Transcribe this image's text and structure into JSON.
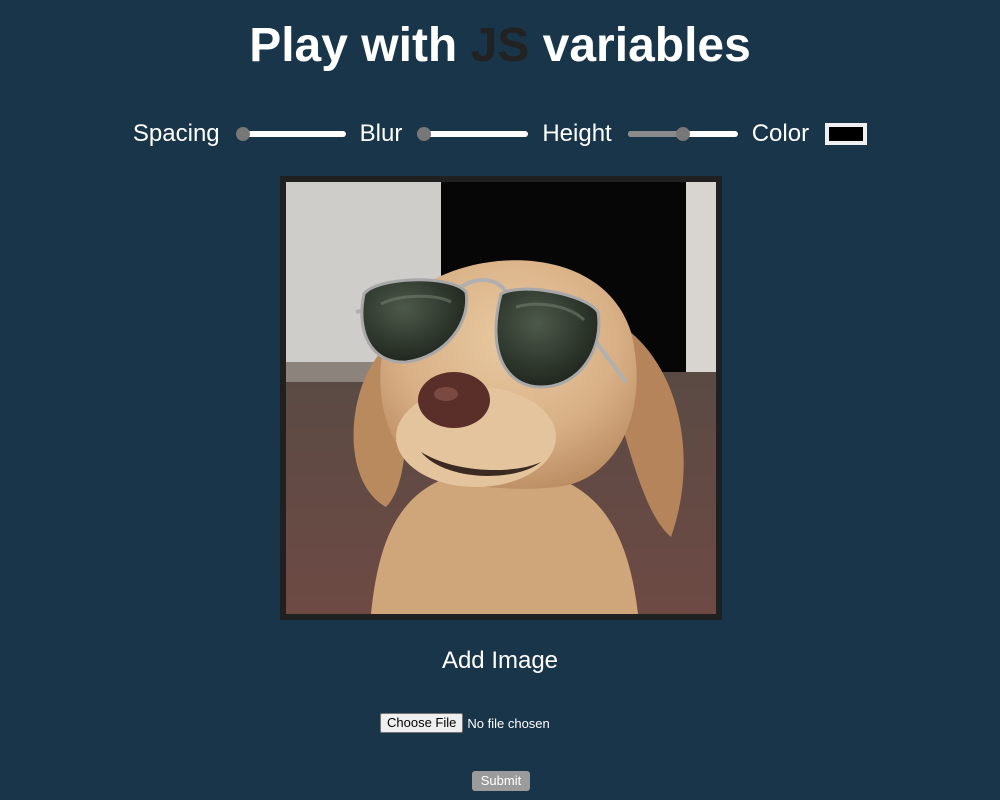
{
  "header": {
    "title_before": "Play with",
    "title_highlight": "JS",
    "title_after": "variables",
    "highlight_color": "#222222"
  },
  "controls": {
    "spacing": {
      "label": "Spacing",
      "fraction": 0.07
    },
    "blur": {
      "label": "Blur",
      "fraction": 0.05
    },
    "height": {
      "label": "Height",
      "fraction": 0.5
    },
    "color": {
      "label": "Color",
      "value": "#000000"
    }
  },
  "main": {
    "image_alt": "dog-with-sunglasses",
    "frame_color": "#202020"
  },
  "form": {
    "add_image_label": "Add Image",
    "choose_file_label": "Choose File",
    "file_status": "No file chosen",
    "submit_label": "Submit"
  },
  "theme": {
    "background": "#193549",
    "text": "#ffffff"
  }
}
